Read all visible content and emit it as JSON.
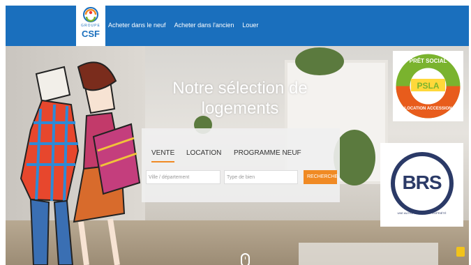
{
  "nav": {
    "logo": {
      "text": "CSF",
      "group_text": "GROUPE"
    },
    "links": [
      "Acheter dans le neuf",
      "Acheter dans l'ancien",
      "Louer"
    ]
  },
  "hero": {
    "title_line1": "Notre sélection de",
    "title_line2": "logements"
  },
  "search": {
    "tabs": [
      "VENTE",
      "LOCATION",
      "PROGRAMME NEUF"
    ],
    "active_tab": "VENTE",
    "location_placeholder": "Ville / département",
    "type_placeholder": "Type de bien",
    "button_label": "RECHERCHER"
  },
  "badges": {
    "psla": {
      "top_text": "PRÊT SOCIAL",
      "center_text": "PSLA",
      "bottom_text": "LOCATION ACCESSION"
    },
    "brs": {
      "center_text": "BRS",
      "caption": "UNE AUTRE IDÉE DE LA PROPRIÉTÉ"
    }
  },
  "colors": {
    "nav_blue": "#1a6fbd",
    "accent_orange": "#f08a24",
    "psla_green": "#7ab32e",
    "psla_orange": "#e85c1c",
    "brs_navy": "#2b3a67"
  },
  "icons": [
    "scroll-mouse-icon",
    "chevron-down-icon",
    "lock-icon"
  ]
}
